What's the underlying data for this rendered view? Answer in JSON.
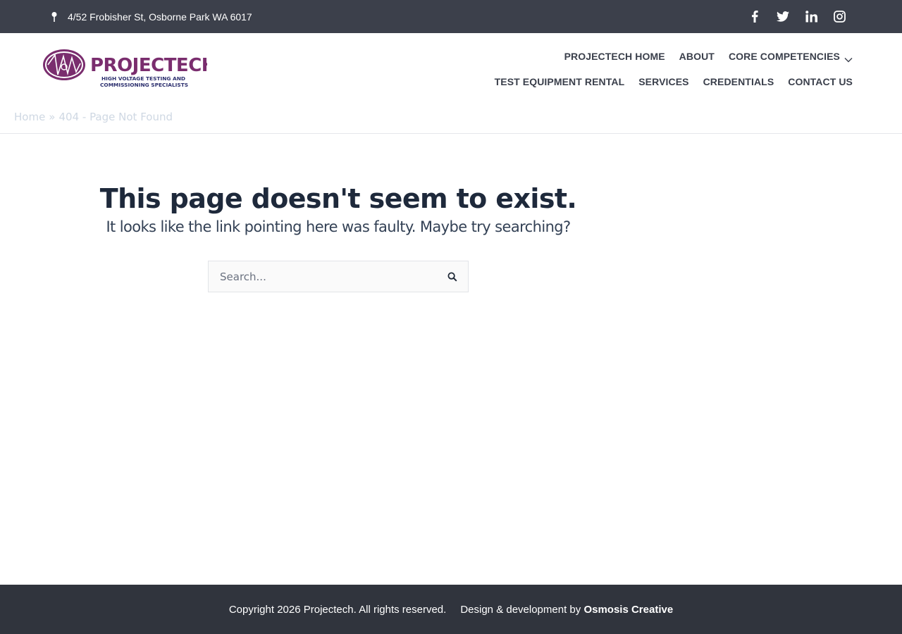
{
  "topbar": {
    "address": "4/52 Frobisher St, Osborne Park WA 6017",
    "social_icons": [
      "facebook-icon",
      "twitter-icon",
      "linkedin-icon",
      "instagram-icon"
    ]
  },
  "brand": {
    "logo_text": "PROJECTECH",
    "logo_tagline_1": "HIGH VOLTAGE TESTING AND",
    "logo_tagline_2": "COMMISSIONING SPECIALISTS",
    "colors": {
      "purple": "#7a2d6e",
      "navy": "#2c2f6e",
      "topbar": "#3c404b",
      "footer": "#30343d"
    }
  },
  "nav": {
    "row1": [
      {
        "label": "PROJECTECH HOME"
      },
      {
        "label": "ABOUT"
      },
      {
        "label": "CORE COMPETENCIES",
        "dropdown": true
      }
    ],
    "row2": [
      {
        "label": "TEST EQUIPMENT RENTAL"
      },
      {
        "label": "SERVICES"
      },
      {
        "label": "CREDENTIALS"
      },
      {
        "label": "CONTACT US"
      }
    ]
  },
  "breadcrumb": {
    "home": "Home",
    "separator": "»",
    "current": "404 - Page Not Found"
  },
  "main": {
    "title": "This page doesn't seem to exist.",
    "subtitle": "It looks like the link pointing here was faulty. Maybe try searching?",
    "search_placeholder": "Search..."
  },
  "footer": {
    "copyright": "Copyright 2026 Projectech. All rights reserved.",
    "credit_prefix": "Design & development by",
    "credit_name": "Osmosis Creative"
  }
}
